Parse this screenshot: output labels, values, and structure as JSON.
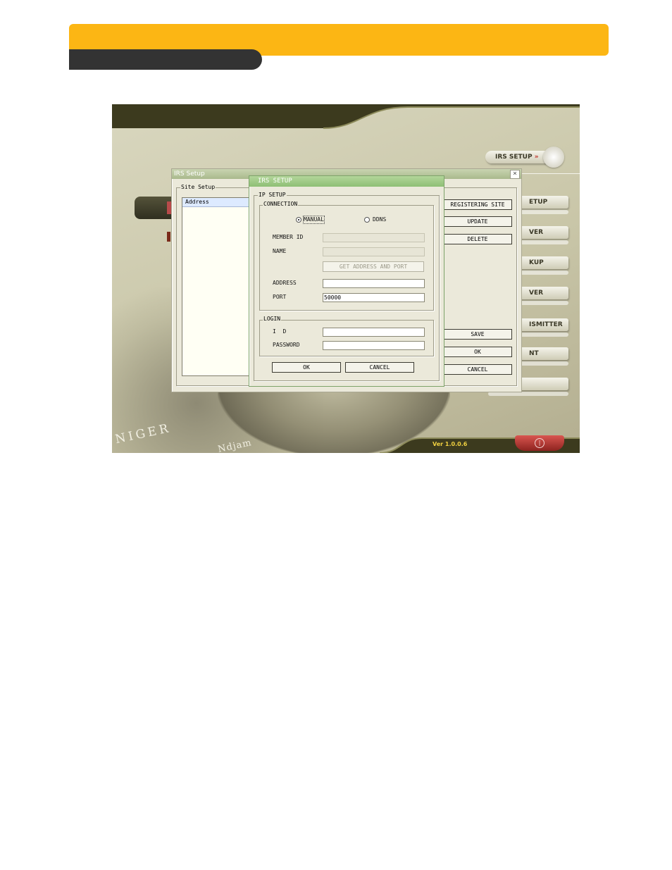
{
  "screenshot": {
    "irs_setup_button": "IRS SETUP",
    "version_label": "Ver 1.0.0.6",
    "side_menu": [
      "ETUP",
      "VER",
      "KUP",
      "VER",
      "ISMITTER",
      "NT"
    ],
    "map_text": [
      "NIGER",
      "Ndjam"
    ]
  },
  "irs_dialog": {
    "title": "IRS Setup",
    "site_setup_label": "Site Setup",
    "list_header": "Address",
    "buttons": {
      "registering_site": "REGISTERING SITE",
      "update": "UPDATE",
      "delete": "DELETE",
      "save": "SAVE",
      "ok": "OK",
      "cancel": "CANCEL"
    }
  },
  "ip_dialog": {
    "title": "IRS SETUP",
    "ip_setup_label": "IP SETUP",
    "connection_label": "CONNECTION",
    "radio_manual": "MANUAL",
    "radio_ddns": "DDNS",
    "selected_connection": "MANUAL",
    "member_id_label": "MEMBER ID",
    "member_id_value": "",
    "name_label": "NAME",
    "name_value": "",
    "get_address_button": "GET ADDRESS AND PORT",
    "address_label": "ADDRESS",
    "address_value": "",
    "port_label": "PORT",
    "port_value": "50000",
    "login_label": "LOGIN",
    "id_label": "I  D",
    "id_value": "",
    "password_label": "PASSWORD",
    "password_value": "",
    "ok_button": "OK",
    "cancel_button": "CANCEL"
  },
  "colors": {
    "banner": "#fcb614",
    "banner_tab": "#333333",
    "topbar": "#3c3a1e",
    "version_text": "#f0d040",
    "power_button": "#b8332f"
  }
}
